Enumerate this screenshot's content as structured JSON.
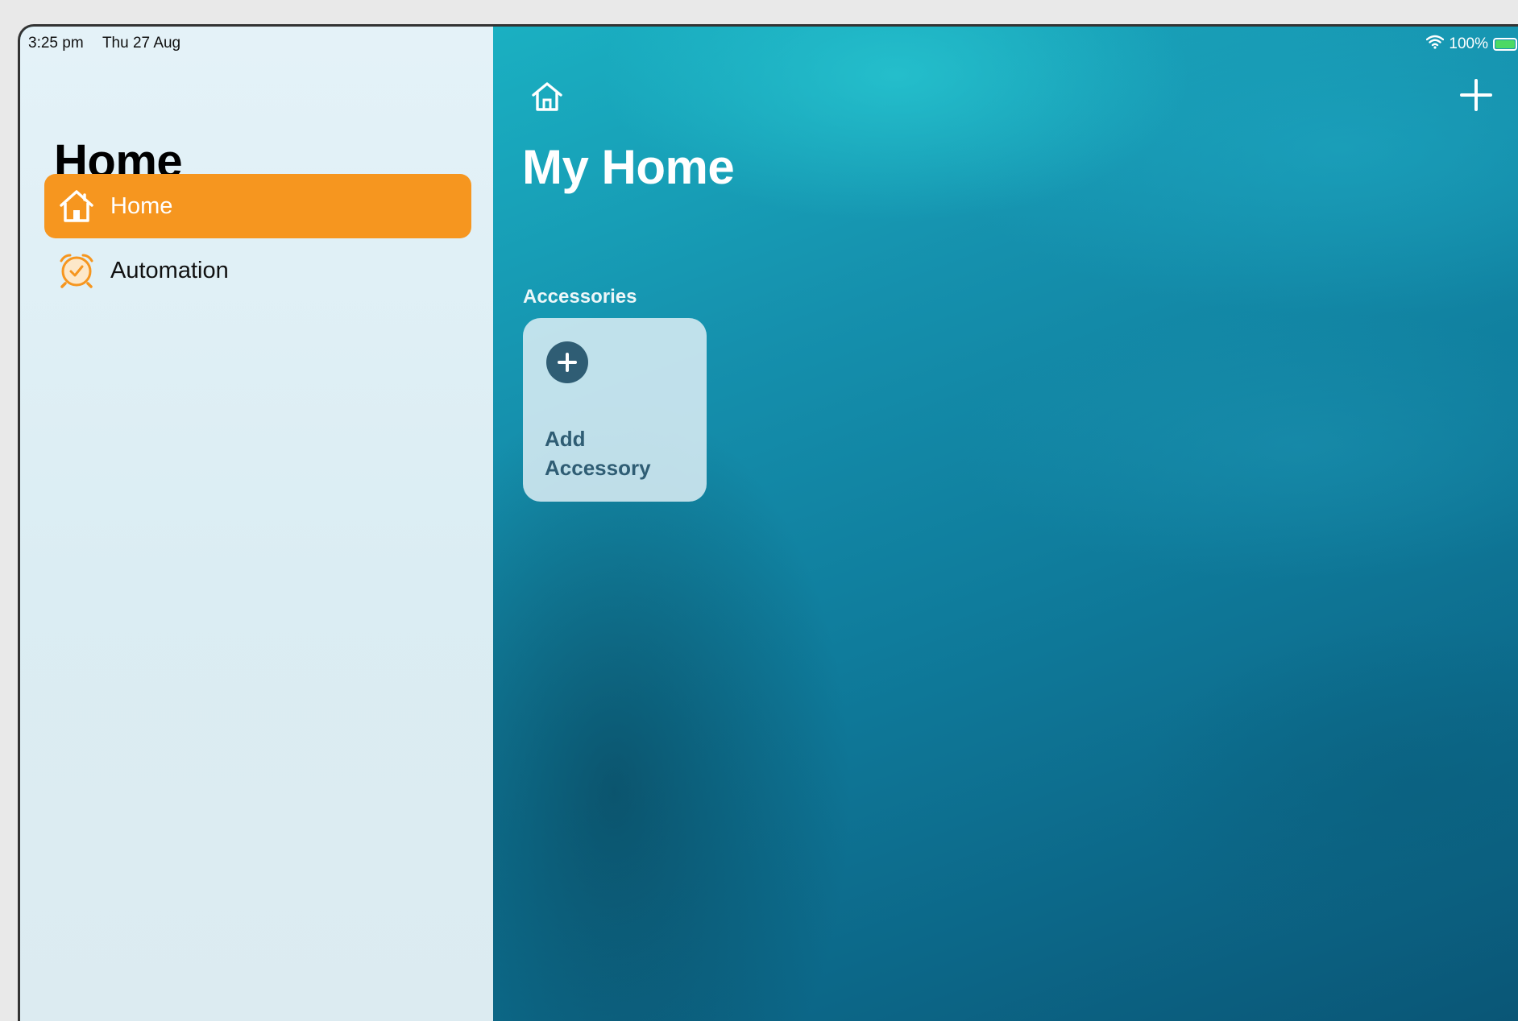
{
  "status_bar": {
    "time": "3:25 pm",
    "date": "Thu 27 Aug",
    "battery_text": "100%",
    "wifi_icon": "wifi-icon",
    "battery_icon": "battery-charging-icon"
  },
  "sidebar": {
    "title": "Home",
    "items": [
      {
        "label": "Home",
        "icon": "house-icon",
        "active": true
      },
      {
        "label": "Automation",
        "icon": "alarm-clock-icon",
        "active": false
      }
    ]
  },
  "main": {
    "home_icon": "house-icon",
    "add_icon": "plus-icon",
    "title": "My Home",
    "section_label": "Accessories",
    "tile": {
      "label_line1": "Add",
      "label_line2": "Accessory",
      "icon": "plus-circle-icon"
    }
  },
  "colors": {
    "accent": "#f6961f",
    "tile_text": "#2f5d74",
    "sidebar_bg": "#e0eff5",
    "main_bg": "#0f7c9c"
  }
}
